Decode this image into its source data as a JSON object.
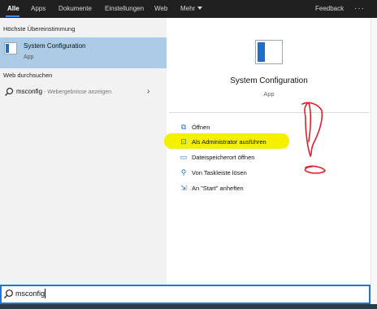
{
  "nav": {
    "tabs": [
      {
        "label": "Alle",
        "active": true
      },
      {
        "label": "Apps"
      },
      {
        "label": "Dokumente"
      },
      {
        "label": "Einstellungen"
      },
      {
        "label": "Web"
      },
      {
        "label": "Mehr"
      }
    ],
    "feedback": "Feedback",
    "more_icon": "ellipsis-icon"
  },
  "left": {
    "best_match_title": "Höchste Übereinstimmung",
    "best_match": {
      "name": "System Configuration",
      "type": "App",
      "icon": "system-configuration-icon"
    },
    "web_title": "Web durchsuchen",
    "web_result": {
      "query": "msconfig",
      "suffix": " - Webergebnisse anzeigen",
      "icon": "search-icon"
    }
  },
  "detail": {
    "name": "System Configuration",
    "type": "App",
    "actions": [
      {
        "label": "Öffnen",
        "icon": "open-icon"
      },
      {
        "label": "Als Administrator ausführen",
        "icon": "run-as-admin-icon",
        "highlighted": true
      },
      {
        "label": "Dateispeicherort öffnen",
        "icon": "file-location-icon"
      },
      {
        "label": "Von Taskleiste lösen",
        "icon": "unpin-taskbar-icon"
      },
      {
        "label": "An \"Start\" anheften",
        "icon": "pin-start-icon"
      }
    ]
  },
  "search": {
    "value": "msconfig",
    "icon": "search-icon"
  },
  "colors": {
    "accent": "#1e78d6",
    "highlight": "#f5f000",
    "annotation": "#e0202a",
    "topbar": "#202020",
    "selected": "#abcbe6"
  }
}
